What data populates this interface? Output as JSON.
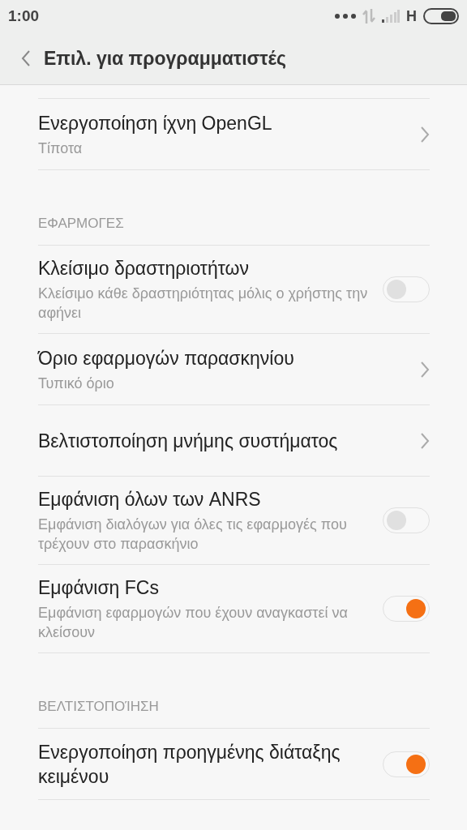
{
  "status_bar": {
    "time": "1:00",
    "network": "H"
  },
  "header": {
    "title": "Επιλ. για προγραμματιστές"
  },
  "sections": [
    {
      "items": [
        {
          "kind": "chevron",
          "title": "Ενεργοποίηση ίχνη OpenGL",
          "subtitle": "Τίποτα"
        }
      ]
    },
    {
      "label": "ΕΦΑΡΜΟΓΕΣ",
      "items": [
        {
          "kind": "toggle",
          "title": "Κλείσιμο δραστηριοτήτων",
          "subtitle": "Κλείσιμο κάθε δραστηριότητας μόλις ο χρήστης την αφήνει",
          "on": false
        },
        {
          "kind": "chevron",
          "title": "Όριο εφαρμογών παρασκηνίου",
          "subtitle": "Τυπικό όριο"
        },
        {
          "kind": "chevron",
          "title": "Βελτιστοποίηση μνήμης συστήματος"
        },
        {
          "kind": "toggle",
          "title": "Εμφάνιση όλων των ANRS",
          "subtitle": "Εμφάνιση διαλόγων για όλες τις εφαρμογές που τρέχουν στο παρασκήνιο",
          "on": false
        },
        {
          "kind": "toggle",
          "title": "Εμφάνιση FCs",
          "subtitle": "Εμφάνιση εφαρμογών που έχουν αναγκαστεί να κλείσουν",
          "on": true
        }
      ]
    },
    {
      "label": "ΒΕΛΤΙΣΤΟΠΟΊΗΣΗ",
      "items": [
        {
          "kind": "toggle",
          "title": "Ενεργοποίηση προηγμένης διάταξης κειμένου",
          "on": true
        }
      ]
    }
  ]
}
